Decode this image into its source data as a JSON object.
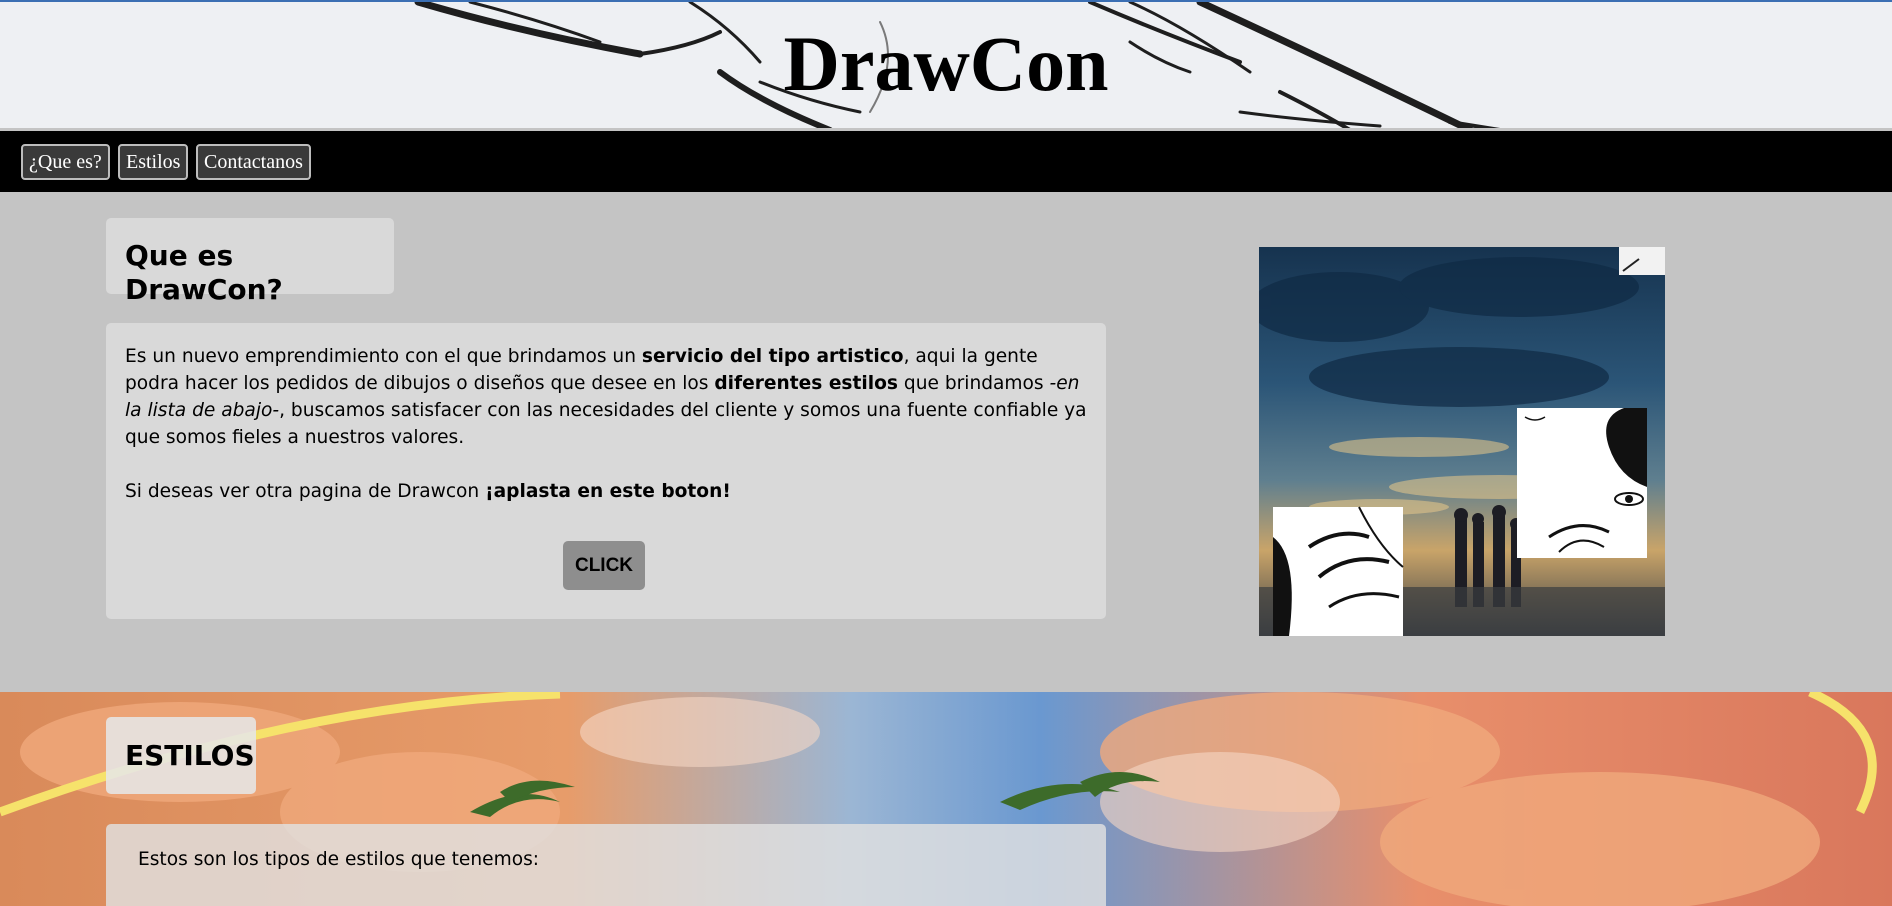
{
  "header": {
    "site_title": "DrawCon"
  },
  "nav": {
    "items": [
      {
        "label": "¿Que es?"
      },
      {
        "label": "Estilos"
      },
      {
        "label": "Contactanos"
      }
    ]
  },
  "intro": {
    "title": "Que es DrawCon?",
    "para1": {
      "t1": "Es un nuevo emprendimiento con el que brindamos un ",
      "b1": "servicio del tipo artistico",
      "t2": ", aqui la gente podra hacer los pedidos de dibujos o diseños que desee en los ",
      "b2": "diferentes estilos",
      "t3": " que brindamos ",
      "i1": "-en la lista de abajo-",
      "t4": ", buscamos satisfacer con las necesidades del cliente y somos una fuente confiable ya que somos fieles a nuestros valores."
    },
    "para2": {
      "t1": "Si deseas ver otra pagina de Drawcon ",
      "b1": "¡aplasta en este boton!"
    },
    "click_label": "CLICK"
  },
  "estilos": {
    "title": "ESTILOS",
    "intro_text": "Estos son los tipos de estilos que tenemos:"
  },
  "colors": {
    "nav_background": "#000000",
    "nav_button": "#3a3a3a",
    "page_background": "#c4c4c4",
    "card_background": "#d9d9d9",
    "click_button": "#8e8e8e",
    "header_border": "#3b6fb3"
  }
}
